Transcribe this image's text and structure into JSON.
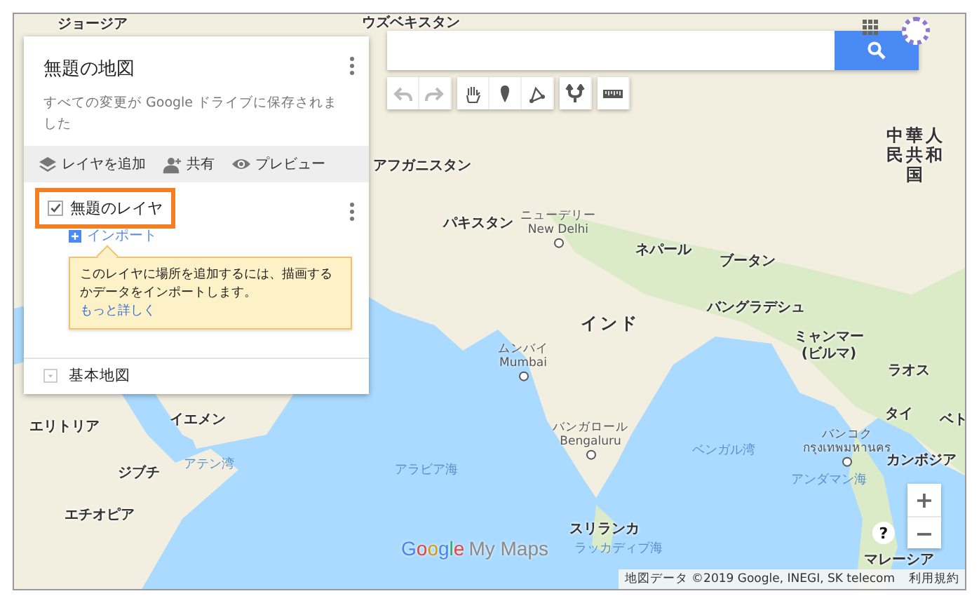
{
  "panel": {
    "title": "無題の地図",
    "status": "すべての変更が Google ドライブに保存されました",
    "actions": [
      {
        "kind": "add-layer",
        "label": "レイヤを追加"
      },
      {
        "kind": "share",
        "label": "共有"
      },
      {
        "kind": "preview",
        "label": "プレビュー"
      }
    ],
    "layer": {
      "name": "無題のレイヤ",
      "checked": true,
      "highlighted": true,
      "import_link": "インポート",
      "tip": "このレイヤに場所を追加するには、描画するかデータをインポートします。",
      "tip_link": "もっと詳しく"
    },
    "base_map": {
      "label": "基本地図",
      "expanded": false
    }
  },
  "toolbar": [
    {
      "kind": "undo",
      "disabled": true
    },
    {
      "kind": "redo",
      "disabled": true
    },
    {
      "kind": "hand",
      "disabled": false
    },
    {
      "kind": "marker",
      "disabled": false
    },
    {
      "kind": "line",
      "disabled": false
    },
    {
      "kind": "directions",
      "disabled": false
    },
    {
      "kind": "ruler",
      "disabled": false
    }
  ],
  "map_labels": [
    {
      "kind": "country",
      "name": "ジョージア"
    },
    {
      "kind": "country",
      "name": "ウズベキスタン"
    },
    {
      "kind": "country",
      "name": "アフガニスタン"
    },
    {
      "kind": "major",
      "name": "中華人民共和国"
    },
    {
      "kind": "country",
      "name": "パキスタン"
    },
    {
      "kind": "city",
      "name": "ニューデリー",
      "name_en": "New Delhi"
    },
    {
      "kind": "country",
      "name": "ネパール"
    },
    {
      "kind": "country",
      "name": "ブータン"
    },
    {
      "kind": "country",
      "name": "バングラデシュ"
    },
    {
      "kind": "major",
      "name": "インド"
    },
    {
      "kind": "country",
      "name": "ミャンマー (ビルマ)"
    },
    {
      "kind": "country",
      "name": "ラオス"
    },
    {
      "kind": "city",
      "name": "ムンバイ",
      "name_en": "Mumbai"
    },
    {
      "kind": "country",
      "name": "タイ"
    },
    {
      "kind": "city",
      "name": "バンコク",
      "name_en": "กรุงเทพมหานคร"
    },
    {
      "kind": "country",
      "name": "ベト"
    },
    {
      "kind": "country",
      "name": "カンボジア"
    },
    {
      "kind": "country",
      "name": "エリトリア"
    },
    {
      "kind": "country",
      "name": "イエメン"
    },
    {
      "kind": "sea",
      "name": "アテン湾"
    },
    {
      "kind": "sea",
      "name": "アラビア海"
    },
    {
      "kind": "city",
      "name": "バンガロール",
      "name_en": "Bengaluru"
    },
    {
      "kind": "sea",
      "name": "ベンガル湾"
    },
    {
      "kind": "sea",
      "name": "アンダマン海"
    },
    {
      "kind": "country",
      "name": "ジブチ"
    },
    {
      "kind": "country",
      "name": "エチオピア"
    },
    {
      "kind": "country",
      "name": "スリランカ"
    },
    {
      "kind": "sea",
      "name": "ラッカディブ海"
    },
    {
      "kind": "country",
      "name": "マレーシア"
    }
  ],
  "logo": {
    "brand": "Google",
    "product": "My Maps"
  },
  "zoom": {
    "in": "+",
    "out": "−"
  },
  "help": "?",
  "attribution": "地図データ ©2019 Google, INEGI, SK telecom",
  "terms": "利用規約"
}
